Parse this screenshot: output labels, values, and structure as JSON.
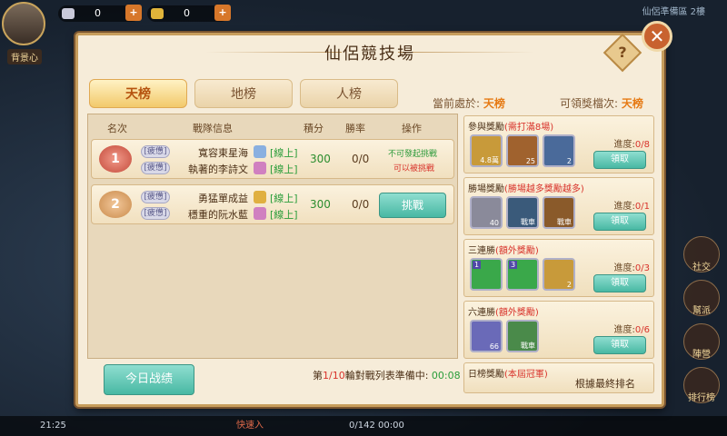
{
  "hud": {
    "player_label": "背景心",
    "silver": "0",
    "gold": "0",
    "top_right_label": "仙侶準備區 2樓",
    "side_icons": [
      "社交",
      "幫派",
      "陣營",
      "排行榜"
    ],
    "bottom_left_time": "21:25",
    "bottom_center_text": "0/142 00:00",
    "bottom_chat": "快速入"
  },
  "panel": {
    "title": "仙侶競技場",
    "help_label": "?",
    "close_label": "✕",
    "tabs": [
      {
        "label": "天榜",
        "active": true
      },
      {
        "label": "地榜",
        "active": false
      },
      {
        "label": "人榜",
        "active": false
      }
    ],
    "current_label": "當前處於:",
    "current_value": "天榜",
    "claimable_label": "可領獎檔次:",
    "claimable_value": "天榜",
    "columns": {
      "rank": "名次",
      "team": "戰隊信息",
      "score": "積分",
      "winrate": "勝率",
      "action": "操作"
    },
    "rows": [
      {
        "rank": "1",
        "tag1": "[疲憊]",
        "p1": "寬容東星海",
        "status1": "[線上]",
        "tag2": "[疲憊]",
        "p2": "執著的李詩文",
        "status2": "[線上]",
        "score": "300",
        "winrate": "0/0",
        "note1": "不可發起挑戰",
        "note2": "可以被挑戰"
      },
      {
        "rank": "2",
        "tag1": "[疲憊]",
        "p1": "勇猛單成益",
        "status1": "[線上]",
        "tag2": "[疲憊]",
        "p2": "穩重的阮水藍",
        "status2": "[線上]",
        "score": "300",
        "winrate": "0/0",
        "button": "挑戰"
      }
    ],
    "today_button": "今日战绩",
    "status_prefix": "第",
    "status_round": "1/10",
    "status_mid": "輪對戰列表準備中:",
    "status_time": "00:08",
    "rewards": [
      {
        "title": "參與獎勵",
        "cond": "(需打滿8場)",
        "progress_label": "進度:",
        "progress": "0/8",
        "button": "領取",
        "items": [
          {
            "count": "4.8萬",
            "color": "#c89a3a"
          },
          {
            "count": "25",
            "color": "#a0622e"
          },
          {
            "count": "2",
            "color": "#4a6a9a"
          }
        ]
      },
      {
        "title": "勝場獎勵",
        "cond": "(勝場越多獎勵越多)",
        "progress_label": "進度:",
        "progress": "0/1",
        "button": "領取",
        "items": [
          {
            "count": "40",
            "color": "#8a8a9a"
          },
          {
            "count": "戰車",
            "color": "#3a5a7a"
          },
          {
            "count": "戰車",
            "color": "#8a5a2a"
          }
        ]
      },
      {
        "title": "三連勝",
        "cond": "(額外獎勵)",
        "progress_label": "進度:",
        "progress": "0/3",
        "button": "領取",
        "items": [
          {
            "count": "",
            "lvl": "1",
            "color": "#3aa84a"
          },
          {
            "count": "",
            "lvl": "3",
            "color": "#3aa84a"
          },
          {
            "count": "2",
            "color": "#c89a3a"
          }
        ]
      },
      {
        "title": "六連勝",
        "cond": "(額外獎勵)",
        "progress_label": "進度:",
        "progress": "0/6",
        "button": "領取",
        "items": [
          {
            "count": "66",
            "color": "#6a6ab8"
          },
          {
            "count": "戰車",
            "color": "#4a8a4a"
          }
        ]
      },
      {
        "title": "日榜獎勵",
        "cond": "(本屆冠軍)",
        "final": "根據最終排名"
      }
    ]
  }
}
